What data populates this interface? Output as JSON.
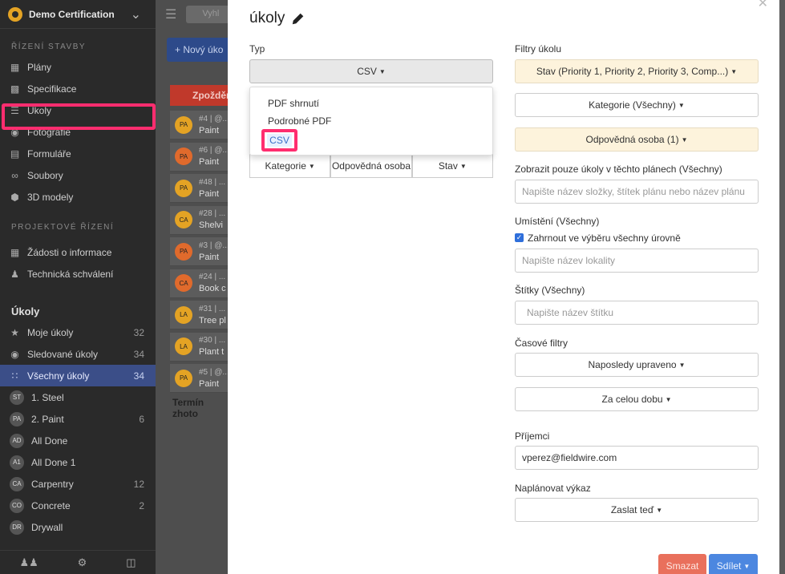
{
  "sidebar": {
    "project": "Demo Certification",
    "section1": "ŘÍZENÍ STAVBY",
    "items1": [
      "Plány",
      "Specifikace",
      "Úkoly",
      "Fotografie",
      "Formuláře",
      "Soubory",
      "3D modely"
    ],
    "section2": "PROJEKTOVÉ ŘÍZENÍ",
    "items2": [
      "Žádosti o informace",
      "Technická schválení"
    ],
    "tasks_title": "Úkoly",
    "task_items": [
      {
        "label": "Moje úkoly",
        "count": "32"
      },
      {
        "label": "Sledované úkoly",
        "count": "34"
      },
      {
        "label": "Všechny úkoly",
        "count": "34"
      }
    ],
    "categories": [
      {
        "badge": "ST",
        "label": "1. Steel",
        "count": ""
      },
      {
        "badge": "PA",
        "label": "2. Paint",
        "count": "6"
      },
      {
        "badge": "AD",
        "label": "All Done",
        "count": ""
      },
      {
        "badge": "A1",
        "label": "All Done 1",
        "count": ""
      },
      {
        "badge": "CA",
        "label": "Carpentry",
        "count": "12"
      },
      {
        "badge": "CO",
        "label": "Concrete",
        "count": "2"
      },
      {
        "badge": "DR",
        "label": "Drywall",
        "count": ""
      }
    ]
  },
  "middle": {
    "search": "Vyhl",
    "new_button": "Nový úko",
    "late_header": "Zpožděn",
    "rows": [
      {
        "pin": "PA",
        "id": "#4 | @...",
        "name": "Paint",
        "color": "#e4a324"
      },
      {
        "pin": "PA",
        "id": "#6 | @...",
        "name": "Paint",
        "color": "#e06a2c"
      },
      {
        "pin": "PA",
        "id": "#48 | ...",
        "name": "Paint",
        "color": "#e4a324"
      },
      {
        "pin": "CA",
        "id": "#28 | ...",
        "name": "Shelvi",
        "color": "#e4a324"
      },
      {
        "pin": "PA",
        "id": "#3 | @...",
        "name": "Paint",
        "color": "#e06a2c"
      },
      {
        "pin": "CA",
        "id": "#24 | ...",
        "name": "Book c",
        "color": "#e06a2c"
      },
      {
        "pin": "LA",
        "id": "#31 | ...",
        "name": "Tree pl",
        "color": "#e4a324"
      },
      {
        "pin": "LA",
        "id": "#30 | ...",
        "name": "Plant t",
        "color": "#e4a324"
      },
      {
        "pin": "PA",
        "id": "#5 | @...",
        "name": "Paint",
        "color": "#e4a324"
      }
    ],
    "termin": "Termín zhoto"
  },
  "modal": {
    "title": "úkoly",
    "type_label": "Typ",
    "type_value": "CSV",
    "dropdown": [
      "PDF shrnutí",
      "Podrobné PDF",
      "CSV"
    ],
    "tabs": [
      "Kategorie",
      "Odpovědná osoba",
      "Stav"
    ],
    "filters_label": "Filtry úkolu",
    "status_filter": "Stav (Priority 1, Priority 2, Priority 3, Comp...)",
    "category_filter": "Kategorie (Všechny)",
    "assignee_filter": "Odpovědná osoba (1)",
    "plans_label": "Zobrazit pouze úkoly v těchto plánech (Všechny)",
    "plans_placeholder": "Napište název složky, štítek plánu nebo název plánu",
    "location_label": "Umístění (Všechny)",
    "include_levels": "Zahrnout ve výběru všechny úrovně",
    "location_placeholder": "Napište název lokality",
    "tags_label": "Štítky (Všechny)",
    "tags_placeholder": "Napište název štítku",
    "time_label": "Časové filtry",
    "time_filter1": "Naposledy upraveno",
    "time_filter2": "Za celou dobu",
    "recipients_label": "Příjemci",
    "recipient_value": "vperez@fieldwire.com",
    "schedule_label": "Naplánovat výkaz",
    "schedule_value": "Zaslat teď",
    "delete_label": "Smazat",
    "share_label": "Sdílet"
  }
}
